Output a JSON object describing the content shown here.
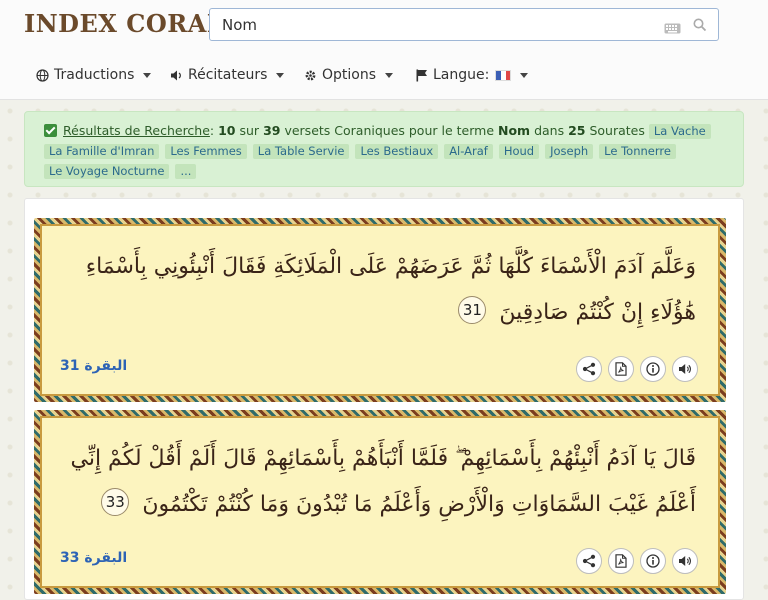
{
  "header": {
    "logo_main": "INDEX",
    "logo_second": "CORAN",
    "search_value": "Nom"
  },
  "nav": {
    "translations": "Traductions",
    "reciters": "Récitateurs",
    "options": "Options",
    "language_label": "Langue:"
  },
  "results": {
    "link": "Résultats de Recherche",
    "count": "10",
    "total": "39",
    "term": "Nom",
    "sourates": "25",
    "text_sur": "sur",
    "text_versets": "versets Coraniques pour le terme",
    "text_dans": "dans",
    "text_sourates": "Sourates",
    "chips": [
      "La Vache",
      "La Famille d'Imran",
      "Les Femmes",
      "La Table Servie",
      "Les Bestiaux",
      "Al-Araf",
      "Houd",
      "Joseph",
      "Le Tonnerre",
      "Le Voyage Nocturne",
      "..."
    ]
  },
  "verses": [
    {
      "text": "وَعَلَّمَ آدَمَ الْأَسْمَاءَ كُلَّهَا ثُمَّ عَرَضَهُمْ عَلَى الْمَلَائِكَةِ فَقَالَ أَنْبِئُونِي بِأَسْمَاءِ هَٰؤُلَاءِ إِنْ كُنْتُمْ صَادِقِينَ",
      "number": "31",
      "reference": "البقرة 31"
    },
    {
      "text": "قَالَ يَا آدَمُ أَنْبِئْهُمْ بِأَسْمَائِهِمْ ۖ فَلَمَّا أَنْبَأَهُمْ بِأَسْمَائِهِمْ قَالَ أَلَمْ أَقُلْ لَكُمْ إِنِّي أَعْلَمُ غَيْبَ السَّمَاوَاتِ وَالْأَرْضِ وَأَعْلَمُ مَا تُبْدُونَ وَمَا كُنْتُمْ تَكْتُمُونَ",
      "number": "33",
      "reference": "البقرة 33"
    }
  ],
  "colors": {
    "logo": "#6b4a2b",
    "alert_bg": "#d9f1d4",
    "chip_text": "#2b6a8c",
    "reference": "#2d63b5",
    "verse_bg": "#fcf4bf"
  },
  "icons": [
    "keyboard-icon",
    "search-icon",
    "globe-icon",
    "volume-icon",
    "gear-icon",
    "flag-icon",
    "share-icon",
    "pdf-icon",
    "info-icon",
    "audio-icon"
  ]
}
